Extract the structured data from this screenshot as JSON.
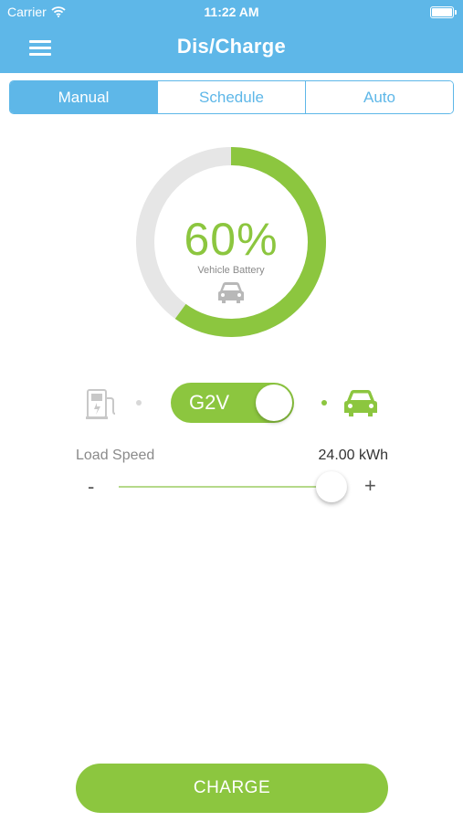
{
  "status_bar": {
    "carrier": "Carrier",
    "time": "11:22 AM"
  },
  "nav": {
    "title": "Dis/Charge",
    "menu_icon": "hamburger-menu-icon"
  },
  "tabs": [
    {
      "label": "Manual",
      "active": true
    },
    {
      "label": "Schedule",
      "active": false
    },
    {
      "label": "Auto",
      "active": false
    }
  ],
  "battery": {
    "percent_text": "60%",
    "percent": 0.6,
    "label": "Vehicle Battery",
    "icon": "car-icon"
  },
  "mode": {
    "label": "G2V",
    "left_icon": "charging-station-icon",
    "right_icon": "car-icon"
  },
  "load_speed": {
    "label": "Load Speed",
    "value": "24.00 kWh",
    "minus": "-",
    "plus": "+",
    "level": 0.93
  },
  "action": {
    "label": "CHARGE"
  },
  "colors": {
    "header": "#5eb7e8",
    "accent_green": "#8cc63f",
    "track_gray": "#e6e6e6"
  }
}
